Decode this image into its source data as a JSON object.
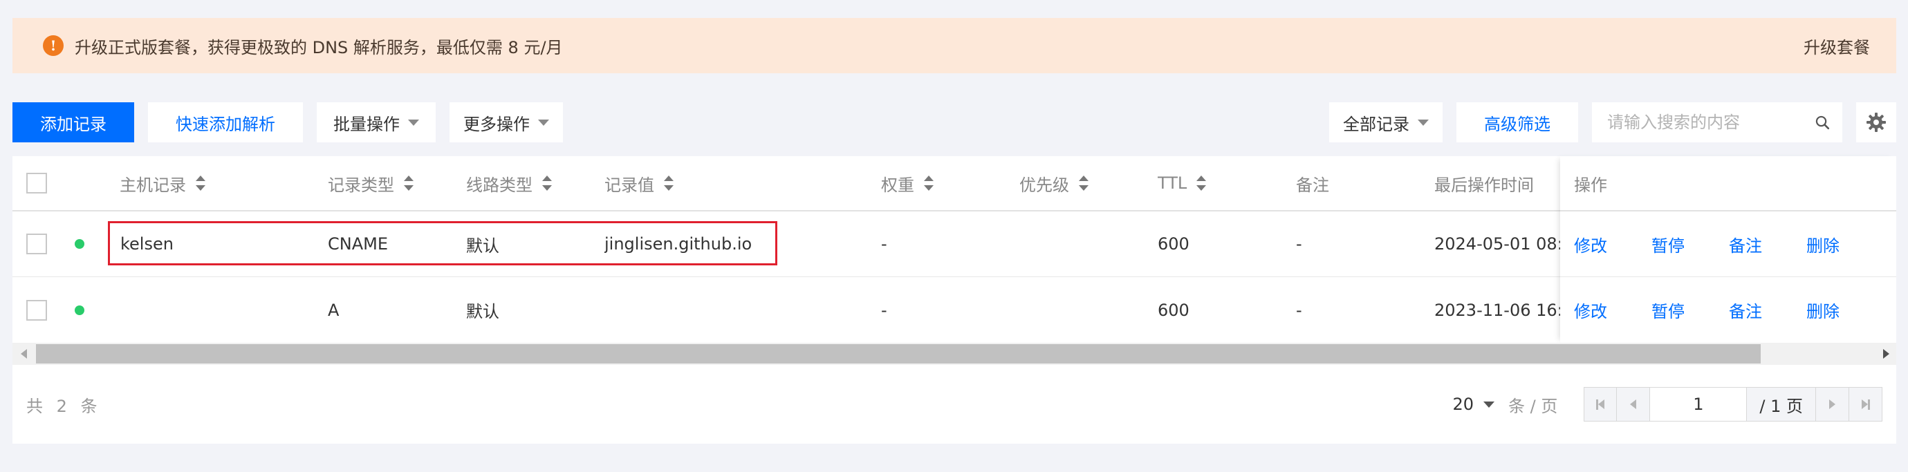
{
  "banner": {
    "text": "升级正式版套餐，获得更极致的 DNS 解析服务，最低仅需 8 元/月",
    "link": "升级套餐"
  },
  "toolbar": {
    "add_record": "添加记录",
    "quick_add": "快速添加解析",
    "batch_ops": "批量操作",
    "more_ops": "更多操作",
    "all_records": "全部记录",
    "advanced_filter": "高级筛选",
    "search_placeholder": "请输入搜索的内容"
  },
  "table": {
    "headers": {
      "host": "主机记录",
      "type": "记录类型",
      "line": "线路类型",
      "value": "记录值",
      "weight": "权重",
      "priority": "优先级",
      "ttl": "TTL",
      "remark": "备注",
      "last_op_time": "最后操作时间",
      "actions": "操作"
    },
    "rows": [
      {
        "host": "kelsen",
        "type": "CNAME",
        "line": "默认",
        "value": "jinglisen.github.io",
        "weight": "-",
        "ttl": "600",
        "remark": "-",
        "last_op_time": "2024-05-01 08:"
      },
      {
        "host": "",
        "type": "A",
        "line": "默认",
        "value": "",
        "weight": "-",
        "ttl": "600",
        "remark": "-",
        "last_op_time": "2023-11-06 16:"
      }
    ],
    "actions": {
      "edit": "修改",
      "pause": "暂停",
      "remark": "备注",
      "delete": "删除"
    }
  },
  "footer": {
    "total": "共 2 条",
    "page_size": "20",
    "per_page": "条 / 页",
    "current_page": "1",
    "total_pages": "/ 1 页"
  },
  "colors": {
    "primary": "#006eff",
    "banner_bg": "#fde8d9",
    "warning_icon": "#f07a1e",
    "status_enabled": "#29cc6a",
    "highlight": "#e0202e"
  }
}
